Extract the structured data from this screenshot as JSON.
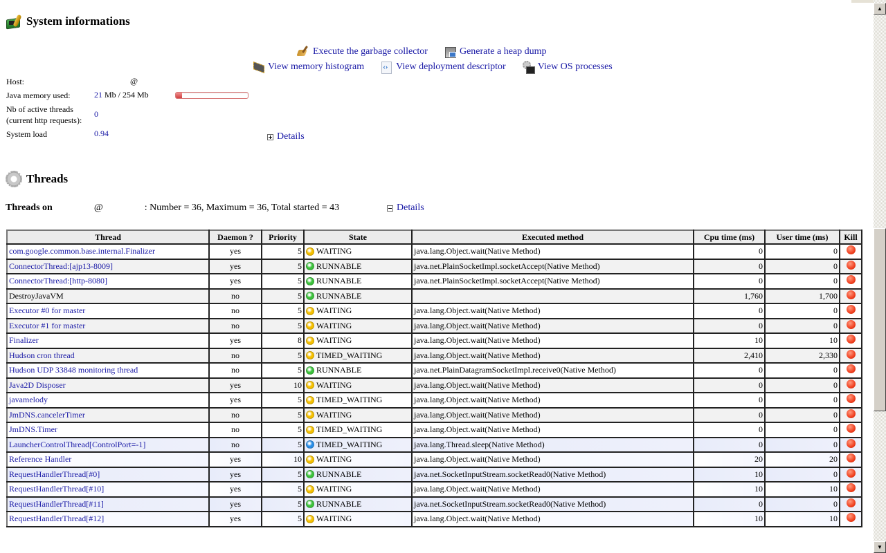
{
  "system": {
    "title": "System informations",
    "actions_row1": [
      {
        "icon": "broom-icon",
        "label": "Execute the garbage collector"
      },
      {
        "icon": "heap-dump-icon",
        "label": "Generate a heap dump"
      }
    ],
    "actions_row2": [
      {
        "icon": "memory-chip-icon",
        "label": "View memory histogram"
      },
      {
        "icon": "xml-descriptor-icon",
        "label": "View deployment descriptor"
      },
      {
        "icon": "os-processes-icon",
        "label": "View OS processes"
      }
    ],
    "host_label": "Host:",
    "host_value": "@",
    "memory_label": "Java memory used:",
    "memory_used": "21",
    "memory_rest": " Mb / 254 Mb",
    "memory_fraction": 0.083,
    "active_threads_label_line1": "Nb of active threads",
    "active_threads_label_line2": "(current http requests):",
    "active_threads_value": "0",
    "system_load_label": "System load",
    "system_load_value": "0.94",
    "details_label": "Details"
  },
  "threads": {
    "title": "Threads",
    "summary_prefix": "Threads on",
    "summary_at": "@",
    "summary_text": ": Number = 36, Maximum = 36, Total started = 43",
    "details_label": "Details",
    "columns": [
      "Thread",
      "Daemon ?",
      "Priority",
      "State",
      "Executed method",
      "Cpu time (ms)",
      "User time (ms)",
      "Kill"
    ],
    "state_colors": {
      "WAITING": "#f5c000",
      "RUNNABLE": "#3cc23c",
      "TIMED_WAITING": "#f5c000",
      "TIMED_WAITING_SLEEP": "#2a8ee8"
    },
    "rows": [
      {
        "name": "com.google.common.base.internal.Finalizer",
        "link": true,
        "daemon": "yes",
        "priority": "5",
        "state": "WAITING",
        "dot": "#f5c000",
        "method": "java.lang.Object.wait(Native Method)",
        "cpu": "0",
        "user": "0"
      },
      {
        "name": "ConnectorThread:[ajp13-8009]",
        "link": true,
        "daemon": "yes",
        "priority": "5",
        "state": "RUNNABLE",
        "dot": "#3cc23c",
        "method": "java.net.PlainSocketImpl.socketAccept(Native Method)",
        "cpu": "0",
        "user": "0"
      },
      {
        "name": "ConnectorThread:[http-8080]",
        "link": true,
        "daemon": "yes",
        "priority": "5",
        "state": "RUNNABLE",
        "dot": "#3cc23c",
        "method": "java.net.PlainSocketImpl.socketAccept(Native Method)",
        "cpu": "0",
        "user": "0"
      },
      {
        "name": "DestroyJavaVM",
        "link": false,
        "daemon": "no",
        "priority": "5",
        "state": "RUNNABLE",
        "dot": "#3cc23c",
        "method": "",
        "cpu": "1,760",
        "user": "1,700"
      },
      {
        "name": "Executor #0 for master",
        "link": true,
        "daemon": "no",
        "priority": "5",
        "state": "WAITING",
        "dot": "#f5c000",
        "method": "java.lang.Object.wait(Native Method)",
        "cpu": "0",
        "user": "0"
      },
      {
        "name": "Executor #1 for master",
        "link": true,
        "daemon": "no",
        "priority": "5",
        "state": "WAITING",
        "dot": "#f5c000",
        "method": "java.lang.Object.wait(Native Method)",
        "cpu": "0",
        "user": "0"
      },
      {
        "name": "Finalizer",
        "link": true,
        "daemon": "yes",
        "priority": "8",
        "state": "WAITING",
        "dot": "#f5c000",
        "method": "java.lang.Object.wait(Native Method)",
        "cpu": "10",
        "user": "10"
      },
      {
        "name": "Hudson cron thread",
        "link": true,
        "daemon": "no",
        "priority": "5",
        "state": "TIMED_WAITING",
        "dot": "#f5c000",
        "method": "java.lang.Object.wait(Native Method)",
        "cpu": "2,410",
        "user": "2,330"
      },
      {
        "name": "Hudson UDP 33848 monitoring thread",
        "link": true,
        "daemon": "no",
        "priority": "5",
        "state": "RUNNABLE",
        "dot": "#3cc23c",
        "method": "java.net.PlainDatagramSocketImpl.receive0(Native Method)",
        "cpu": "0",
        "user": "0"
      },
      {
        "name": "Java2D Disposer",
        "link": true,
        "daemon": "yes",
        "priority": "10",
        "state": "WAITING",
        "dot": "#f5c000",
        "method": "java.lang.Object.wait(Native Method)",
        "cpu": "0",
        "user": "0"
      },
      {
        "name": "javamelody",
        "link": true,
        "daemon": "yes",
        "priority": "5",
        "state": "TIMED_WAITING",
        "dot": "#f5c000",
        "method": "java.lang.Object.wait(Native Method)",
        "cpu": "0",
        "user": "0"
      },
      {
        "name": "JmDNS.cancelerTimer",
        "link": true,
        "daemon": "no",
        "priority": "5",
        "state": "WAITING",
        "dot": "#f5c000",
        "method": "java.lang.Object.wait(Native Method)",
        "cpu": "0",
        "user": "0"
      },
      {
        "name": "JmDNS.Timer",
        "link": true,
        "daemon": "no",
        "priority": "5",
        "state": "TIMED_WAITING",
        "dot": "#f5c000",
        "method": "java.lang.Object.wait(Native Method)",
        "cpu": "0",
        "user": "0"
      },
      {
        "name": "LauncherControlThread[ControlPort=-1]",
        "link": true,
        "daemon": "no",
        "priority": "5",
        "state": "TIMED_WAITING",
        "dot": "#2a8ee8",
        "method": "java.lang.Thread.sleep(Native Method)",
        "cpu": "0",
        "user": "0"
      },
      {
        "name": "Reference Handler",
        "link": true,
        "daemon": "yes",
        "priority": "10",
        "state": "WAITING",
        "dot": "#f5c000",
        "method": "java.lang.Object.wait(Native Method)",
        "cpu": "20",
        "user": "20"
      },
      {
        "name": "RequestHandlerThread[#0]",
        "link": true,
        "daemon": "yes",
        "priority": "5",
        "state": "RUNNABLE",
        "dot": "#3cc23c",
        "method": "java.net.SocketInputStream.socketRead0(Native Method)",
        "cpu": "10",
        "user": "0"
      },
      {
        "name": "RequestHandlerThread[#10]",
        "link": true,
        "daemon": "yes",
        "priority": "5",
        "state": "WAITING",
        "dot": "#f5c000",
        "method": "java.lang.Object.wait(Native Method)",
        "cpu": "10",
        "user": "10"
      },
      {
        "name": "RequestHandlerThread[#11]",
        "link": true,
        "daemon": "yes",
        "priority": "5",
        "state": "RUNNABLE",
        "dot": "#3cc23c",
        "method": "java.net.SocketInputStream.socketRead0(Native Method)",
        "cpu": "0",
        "user": "0"
      },
      {
        "name": "RequestHandlerThread[#12]",
        "link": true,
        "daemon": "yes",
        "priority": "5",
        "state": "WAITING",
        "dot": "#f5c000",
        "method": "java.lang.Object.wait(Native Method)",
        "cpu": "10",
        "user": "10"
      }
    ]
  },
  "colors": {
    "link": "#1a1aa6",
    "kill": "#f04020",
    "memory_bar": "#d04040"
  }
}
